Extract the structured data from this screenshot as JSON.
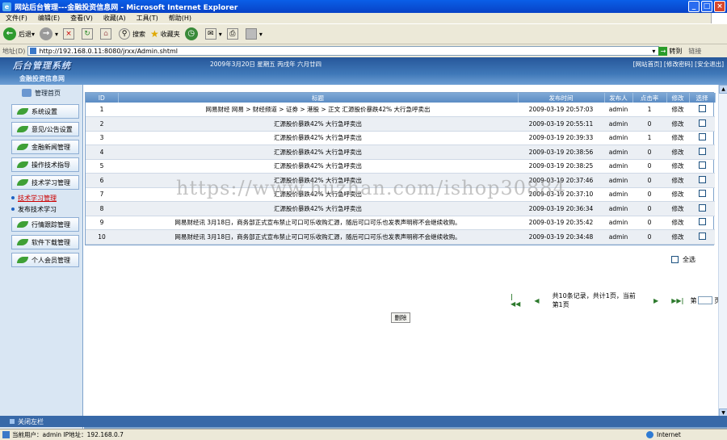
{
  "window": {
    "title": "网站后台管理---金融投资信息网 - Microsoft Internet Explorer"
  },
  "menu": [
    "文件(F)",
    "编辑(E)",
    "查看(V)",
    "收藏(A)",
    "工具(T)",
    "帮助(H)"
  ],
  "toolbar": {
    "back": "后退",
    "search": "搜索",
    "favorites": "收藏夹"
  },
  "address": {
    "label": "地址(D)",
    "url": "http://192.168.0.11:8080/jrxx/Admin.shtml",
    "go": "转到",
    "links": "链接"
  },
  "header": {
    "logo": "后台管理系统",
    "subtitle": "金融投资信息网",
    "date": "2009年3月20日 星期五 丙戌年 六月廿四",
    "links": "[网站首页] [修改密码] [安全退出]"
  },
  "sidebar": {
    "home": "管理首页",
    "items": [
      "系统设置",
      "意见/公告设置",
      "金融新闻管理",
      "操作技术指导",
      "技术学习管理"
    ],
    "subitems": [
      "技术学习管理",
      "发布技术学习"
    ],
    "items2": [
      "行情跟踪管理",
      "软件下载管理",
      "个人会员管理"
    ]
  },
  "table": {
    "headers": [
      "ID",
      "标题",
      "发布时间",
      "发布人",
      "点击率",
      "修改",
      "选择"
    ],
    "rows": [
      {
        "id": "1",
        "title": "网易财经 网易 > 财经频道 > 证券 > 港股 > 正文 汇源股价暴跌42% 大行急呼卖出",
        "time": "2009-03-19 20:57:03",
        "user": "admin",
        "clicks": "1",
        "edit": "修改"
      },
      {
        "id": "2",
        "title": "汇源股价暴跌42% 大行急呼卖出",
        "time": "2009-03-19 20:55:11",
        "user": "admin",
        "clicks": "0",
        "edit": "修改"
      },
      {
        "id": "3",
        "title": "汇源股价暴跌42% 大行急呼卖出",
        "time": "2009-03-19 20:39:33",
        "user": "admin",
        "clicks": "1",
        "edit": "修改"
      },
      {
        "id": "4",
        "title": "汇源股价暴跌42% 大行急呼卖出",
        "time": "2009-03-19 20:38:56",
        "user": "admin",
        "clicks": "0",
        "edit": "修改"
      },
      {
        "id": "5",
        "title": "汇源股价暴跌42% 大行急呼卖出",
        "time": "2009-03-19 20:38:25",
        "user": "admin",
        "clicks": "0",
        "edit": "修改"
      },
      {
        "id": "6",
        "title": "汇源股价暴跌42% 大行急呼卖出",
        "time": "2009-03-19 20:37:46",
        "user": "admin",
        "clicks": "0",
        "edit": "修改"
      },
      {
        "id": "7",
        "title": "汇源股价暴跌42% 大行急呼卖出",
        "time": "2009-03-19 20:37:10",
        "user": "admin",
        "clicks": "0",
        "edit": "修改"
      },
      {
        "id": "8",
        "title": "汇源股价暴跌42% 大行急呼卖出",
        "time": "2009-03-19 20:36:34",
        "user": "admin",
        "clicks": "0",
        "edit": "修改"
      },
      {
        "id": "9",
        "title": "网易财经讯 3月18日，商务部正式宣布禁止可口可乐收购汇源，随后可口可乐也发表声明称不会继续收购。",
        "time": "2009-03-19 20:35:42",
        "user": "admin",
        "clicks": "0",
        "edit": "修改"
      },
      {
        "id": "10",
        "title": "网易财经讯 3月18日，商务部正式宣布禁止可口可乐收购汇源，随后可口可乐也发表声明称不会继续收购。",
        "time": "2009-03-19 20:34:48",
        "user": "admin",
        "clicks": "0",
        "edit": "修改"
      }
    ],
    "select_all": "全选"
  },
  "pager": {
    "info": "共10条记录，共计1页，当前第1页",
    "page_prefix": "第",
    "page_suffix": "页"
  },
  "delete_label": "删除",
  "close_sidebar": "关闭左栏",
  "status": {
    "left": "当前用户：admin  IP地址：192.168.0.7",
    "zone": "Internet"
  },
  "watermark": "https://www.huzhan.com/ishop30884"
}
